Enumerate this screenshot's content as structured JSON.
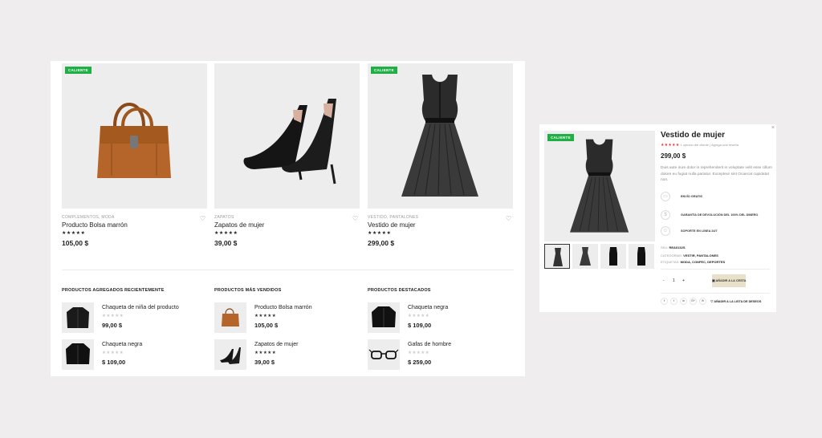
{
  "products": [
    {
      "badge": "CALIENTE",
      "category": "COMPLEMENTOS, MODA",
      "name": "Producto Bolsa marrón",
      "stars": "★★★★★",
      "price": "105,00 $"
    },
    {
      "badge": "",
      "category": "ZAPATOS",
      "name": "Zapatos de mujer",
      "stars": "★★★★★",
      "price": "39,00 $"
    },
    {
      "badge": "CALIENTE",
      "category": "VESTIDO, PANTALONES",
      "name": "Vestido de mujer",
      "stars": "★★★★★",
      "price": "299,00 $"
    }
  ],
  "icons": {
    "heart": "heart-icon",
    "close": "close-icon",
    "cart": "cart-icon"
  },
  "colors": {
    "badge": "#1fb045",
    "add_to_cart": "#e8e0c9",
    "rating_stars": "#e53935"
  },
  "lists": [
    {
      "title": "PRODUCTOS AGREGADOS RECIENTEMENTE",
      "items": [
        {
          "name": "Chaqueta de niña del producto",
          "stars": "★★★★★",
          "rated": false,
          "price": "99,00 $"
        },
        {
          "name": "Chaqueta negra",
          "stars": "★★★★★",
          "rated": false,
          "price": "$ 109,00"
        }
      ]
    },
    {
      "title": "PRODUCTOS MÁS VENDIDOS",
      "items": [
        {
          "name": "Producto Bolsa marrón",
          "stars": "★★★★★",
          "rated": true,
          "price": "105,00 $"
        },
        {
          "name": "Zapatos de mujer",
          "stars": "★★★★★",
          "rated": true,
          "price": "39,00 $"
        }
      ]
    },
    {
      "title": "PRODUCTOS DESTACADOS",
      "items": [
        {
          "name": "Chaqueta negra",
          "stars": "★★★★★",
          "rated": false,
          "price": "$ 109,00"
        },
        {
          "name": "Gafas de hombre",
          "stars": "★★★★★",
          "rated": false,
          "price": "$ 259,00"
        }
      ]
    }
  ],
  "quickview": {
    "close": "×",
    "badge": "CALIENTE",
    "title": "Vestido de mujer",
    "stars": "★★★★★",
    "reviews": "1 opinión del cliente",
    "add_review": "Agrega una reseña",
    "price": "299,00 $",
    "description": "Duis aute irure dolor in reprehenderit in voluptate velit esse cillum dolore eu fugiat nulla pariatur. Excepteur sint Ocaecat cupidatat non.",
    "features": [
      "ENVÍO GRATIS",
      "GARANTÍA DE DEVOLUCIÓN DEL 100% DEL DINERO",
      "SOPORTE EN LÍNEA 24/7"
    ],
    "sku_label": "SKU:",
    "sku": "REA0132S",
    "categories_label": "CATEGORÍAS:",
    "categories": "VESTIR, PANTALONES",
    "tags_label": "ETIQUETAS:",
    "tags": "MODA, CONFEC, DEPORTES",
    "qty_minus": "-",
    "qty_value": "1",
    "qty_plus": "+",
    "add_to_cart": "AÑADIR A LA CESTA",
    "social": [
      "f",
      "t",
      "in",
      "G+",
      "✉"
    ],
    "wishlist": "AÑADIR A LA LISTA DE DESEOS"
  }
}
